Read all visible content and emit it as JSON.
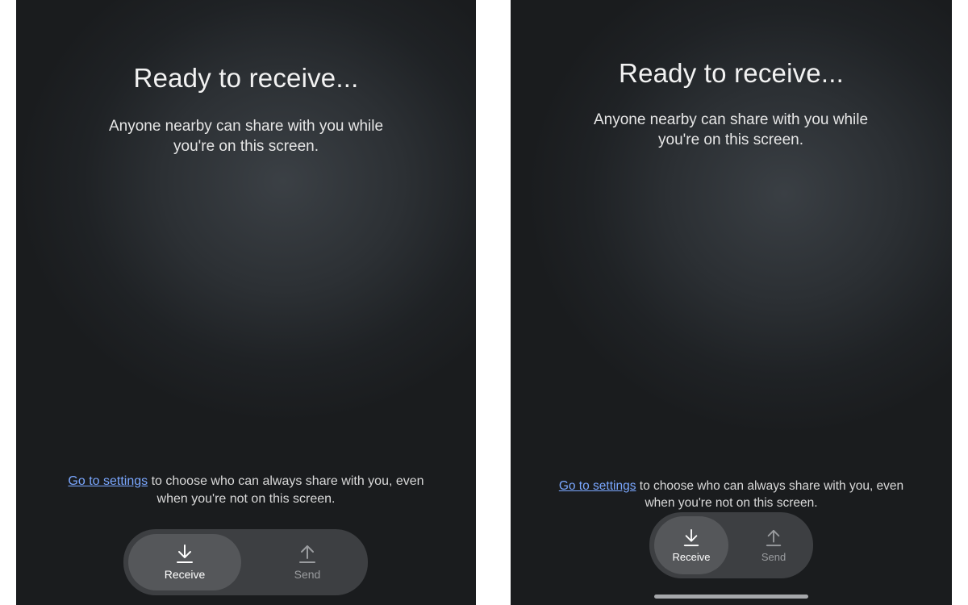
{
  "screens": [
    {
      "title": "Ready to receive...",
      "subtitle_line1": "Anyone nearby can share with you while",
      "subtitle_line2": "you're on this screen.",
      "settings_link": "Go to settings",
      "settings_rest_line1": " to choose who can always share with you, even",
      "settings_line2": "when you're not on this screen.",
      "tabs": [
        {
          "label": "Receive",
          "icon": "download-arrow-icon",
          "active": true
        },
        {
          "label": "Send",
          "icon": "upload-arrow-icon",
          "active": false
        }
      ]
    },
    {
      "title": "Ready to receive...",
      "subtitle_line1": "Anyone nearby can share with you while",
      "subtitle_line2": "you're on this screen.",
      "settings_link": "Go to settings",
      "settings_rest_line1": " to choose who can always share with you, even",
      "settings_line2": "when you're not on this screen.",
      "tabs": [
        {
          "label": "Receive",
          "icon": "download-arrow-icon",
          "active": true
        },
        {
          "label": "Send",
          "icon": "upload-arrow-icon",
          "active": false
        }
      ]
    }
  ],
  "colors": {
    "link": "#7aa7ff",
    "pill_bg": "#3d3f42",
    "active_segment_bg": "#55575a"
  }
}
